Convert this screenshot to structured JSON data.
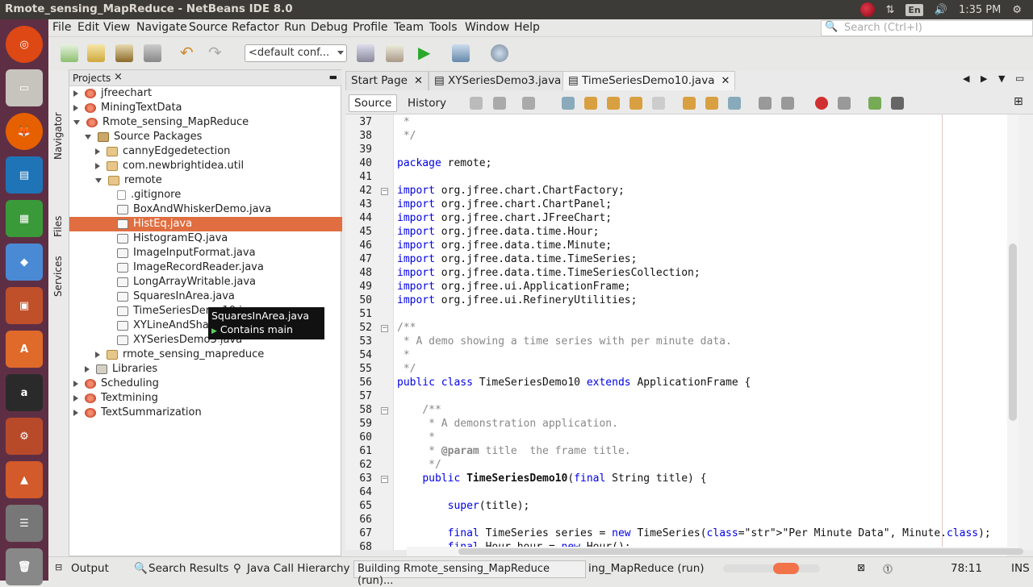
{
  "window": {
    "title": "Rmote_sensing_MapReduce - NetBeans IDE 8.0"
  },
  "tray": {
    "lang": "En",
    "time": "1:35 PM"
  },
  "menu": {
    "items": [
      "File",
      "Edit",
      "View",
      "Navigate",
      "Source",
      "Refactor",
      "Run",
      "Debug",
      "Profile",
      "Team",
      "Tools",
      "Window",
      "Help"
    ],
    "search_placeholder": "Search (Ctrl+I)"
  },
  "toolbar": {
    "config": "<default conf..."
  },
  "projects": {
    "tab_label": "Projects",
    "tab_close": "×",
    "tree": [
      {
        "label": "jfreechart"
      },
      {
        "label": "MiningTextData"
      },
      {
        "label": "Rmote_sensing_MapReduce"
      },
      {
        "label": "Source Packages"
      },
      {
        "label": "cannyEdgedetection"
      },
      {
        "label": "com.newbrightidea.util"
      },
      {
        "label": "remote"
      },
      {
        "label": ".gitignore"
      },
      {
        "label": "BoxAndWhiskerDemo.java"
      },
      {
        "label": "HistEq.java"
      },
      {
        "label": "HistogramEQ.java"
      },
      {
        "label": "ImageInputFormat.java"
      },
      {
        "label": "ImageRecordReader.java"
      },
      {
        "label": "LongArrayWritable.java"
      },
      {
        "label": "SquaresInArea.java"
      },
      {
        "label": "TimeSeriesDemo10.java"
      },
      {
        "label": "XYLineAndSha"
      },
      {
        "label": "XYSeriesDemo3.java"
      },
      {
        "label": "rmote_sensing_mapreduce"
      },
      {
        "label": "Libraries"
      },
      {
        "label": "Scheduling"
      },
      {
        "label": "Textmining"
      },
      {
        "label": "TextSummarization"
      }
    ],
    "tooltip": {
      "title": "SquaresInArea.java",
      "detail": "Contains main class."
    }
  },
  "side_tabs": [
    "Navigator",
    "Files",
    "Services"
  ],
  "editor": {
    "tabs": [
      {
        "label": "Start Page"
      },
      {
        "label": "XYSeriesDemo3.java"
      },
      {
        "label": "TimeSeriesDemo10.java"
      }
    ],
    "source_label": "Source",
    "history_label": "History",
    "lines": [
      {
        "n": "37",
        "t": " *"
      },
      {
        "n": "38",
        "t": " */"
      },
      {
        "n": "39",
        "t": ""
      },
      {
        "n": "40",
        "t": "package remote;"
      },
      {
        "n": "41",
        "t": ""
      },
      {
        "n": "42",
        "t": "import org.jfree.chart.ChartFactory;"
      },
      {
        "n": "43",
        "t": "import org.jfree.chart.ChartPanel;"
      },
      {
        "n": "44",
        "t": "import org.jfree.chart.JFreeChart;"
      },
      {
        "n": "45",
        "t": "import org.jfree.data.time.Hour;"
      },
      {
        "n": "46",
        "t": "import org.jfree.data.time.Minute;"
      },
      {
        "n": "47",
        "t": "import org.jfree.data.time.TimeSeries;"
      },
      {
        "n": "48",
        "t": "import org.jfree.data.time.TimeSeriesCollection;"
      },
      {
        "n": "49",
        "t": "import org.jfree.ui.ApplicationFrame;"
      },
      {
        "n": "50",
        "t": "import org.jfree.ui.RefineryUtilities;"
      },
      {
        "n": "51",
        "t": ""
      },
      {
        "n": "52",
        "t": "/**"
      },
      {
        "n": "53",
        "t": " * A demo showing a time series with per minute data."
      },
      {
        "n": "54",
        "t": " *"
      },
      {
        "n": "55",
        "t": " */"
      },
      {
        "n": "56",
        "t": "public class TimeSeriesDemo10 extends ApplicationFrame {"
      },
      {
        "n": "57",
        "t": ""
      },
      {
        "n": "58",
        "t": "    /**"
      },
      {
        "n": "59",
        "t": "     * A demonstration application."
      },
      {
        "n": "60",
        "t": "     *"
      },
      {
        "n": "61",
        "t": "     * @param title  the frame title."
      },
      {
        "n": "62",
        "t": "     */"
      },
      {
        "n": "63",
        "t": "    public TimeSeriesDemo10(final String title) {"
      },
      {
        "n": "64",
        "t": ""
      },
      {
        "n": "65",
        "t": "        super(title);"
      },
      {
        "n": "66",
        "t": ""
      },
      {
        "n": "67",
        "t": "        final TimeSeries series = new TimeSeries(\"Per Minute Data\", Minute.class);"
      },
      {
        "n": "68",
        "t": "        final Hour hour = new Hour();"
      }
    ]
  },
  "status": {
    "output": "Output",
    "search_results": "Search Results",
    "call_hierarchy": "Java Call Hierarchy",
    "building": "Building Rmote_sensing_MapReduce (run)...",
    "task": "ing_MapReduce (run)",
    "caret": "78:11",
    "mode": "INS"
  }
}
